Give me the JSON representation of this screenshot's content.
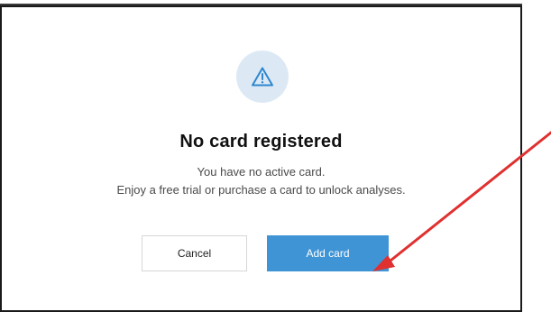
{
  "dialog": {
    "icon": "warning-triangle-icon",
    "title": "No card registered",
    "message_line1": "You have no active card.",
    "message_line2": "Enjoy a free trial or purchase a card to unlock analyses.",
    "cancel_label": "Cancel",
    "add_card_label": "Add card"
  },
  "colors": {
    "accent": "#3f94d6",
    "icon_background": "#dce9f5",
    "icon_stroke": "#2f86cf",
    "annotation_arrow": "#e03030"
  },
  "annotation": {
    "icon": "red-arrow-pointing-to-add-card-button"
  }
}
